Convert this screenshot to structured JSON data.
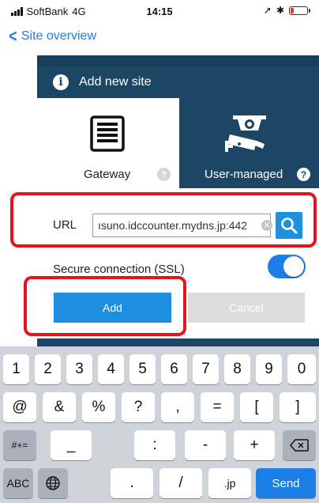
{
  "status_bar": {
    "carrier": "SoftBank",
    "network": "4G",
    "time": "14:15"
  },
  "nav": {
    "back_label": "Site overview"
  },
  "dialog": {
    "title": "Add new site",
    "site_types": [
      {
        "label": "Gateway",
        "icon": "gateway-icon",
        "selected": false
      },
      {
        "label": "User-managed",
        "icon": "security-camera-icon",
        "selected": true
      }
    ],
    "url": {
      "label": "URL",
      "value": "ısuno.idccounter.mydns.jp:442"
    },
    "ssl": {
      "label": "Secure connection (SSL)",
      "enabled": true
    },
    "add_label": "Add",
    "cancel_label": "Cancel"
  },
  "keyboard": {
    "row1": [
      "1",
      "2",
      "3",
      "4",
      "5",
      "6",
      "7",
      "8",
      "9",
      "0"
    ],
    "row2": [
      "@",
      "&",
      "%",
      "?",
      ",",
      "=",
      "[",
      "]"
    ],
    "row3_mod": "#+=",
    "row3": [
      "_",
      ":",
      "-",
      "+"
    ],
    "row4": {
      "abc": "ABC",
      "dot": ".",
      "slash": "/",
      "jp": ".jp",
      "send": "Send"
    }
  },
  "colors": {
    "accent": "#1e8fe0",
    "header_navy": "#1c4664",
    "highlight_red": "#e8141b",
    "keyboard_bg": "#cfd3d9"
  }
}
